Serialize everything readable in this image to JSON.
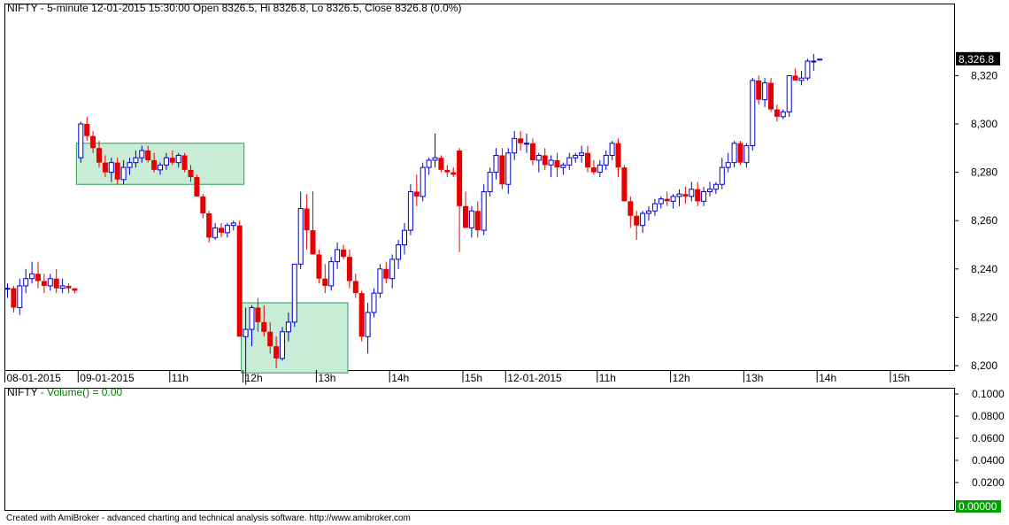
{
  "header": {
    "symbol": "NIFTY",
    "detail": " - 5-minute 12-01-2015 15:30:00 Open 8326.5, Hi 8326.8, Lo 8326.5, Close 8326.8 (0.0%)"
  },
  "volume_header": {
    "symbol": "NIFTY",
    "label": " - Volume() = 0.00"
  },
  "footer": "Created with AmiBroker - advanced charting and technical analysis software. http://www.amibroker.com",
  "colors": {
    "up": "#0000cc",
    "down": "#e60000",
    "box_fill": "#c8ecd6",
    "box_stroke": "#2f9c56",
    "last_tag": "#000000",
    "vol_tag": "#00a000",
    "volume_text": "#008000"
  },
  "chart_data": [
    {
      "type": "candlestick",
      "ylim": [
        8190,
        8330
      ],
      "yticks": [
        "8,200",
        "8,220",
        "8,240",
        "8,260",
        "8,280",
        "8,300",
        "8,320"
      ],
      "ytick_values": [
        8200,
        8220,
        8240,
        8260,
        8280,
        8300,
        8320
      ],
      "last_value_label": "8,326.8",
      "last_value": 8326.8,
      "x_labels": [
        {
          "label": "08-01-2015",
          "index": 0
        },
        {
          "label": "09-01-2015",
          "index": 12
        },
        {
          "label": "11h",
          "index": 27
        },
        {
          "label": "12h",
          "index": 39
        },
        {
          "label": "13h",
          "index": 51
        },
        {
          "label": "14h",
          "index": 63
        },
        {
          "label": "15h",
          "index": 75
        },
        {
          "label": "12-01-2015",
          "index": 82
        },
        {
          "label": "11h",
          "index": 97
        },
        {
          "label": "12h",
          "index": 109
        },
        {
          "label": "13h",
          "index": 121
        },
        {
          "label": "14h",
          "index": 133
        },
        {
          "label": "15h",
          "index": 145
        }
      ],
      "highlight_boxes": [
        {
          "from_index": 12,
          "to_index": 38,
          "low": 8275,
          "high": 8292
        },
        {
          "from_index": 39,
          "to_index": 55,
          "low": 8197,
          "high": 8226
        }
      ],
      "candles": [
        [
          8232,
          8234,
          8228,
          8232
        ],
        [
          8232,
          8233,
          8222,
          8224
        ],
        [
          8224,
          8236,
          8221,
          8233
        ],
        [
          8233,
          8240,
          8230,
          8236
        ],
        [
          8236,
          8243,
          8234,
          8238
        ],
        [
          8238,
          8243,
          8232,
          8235
        ],
        [
          8235,
          8238,
          8230,
          8233
        ],
        [
          8233,
          8238,
          8231,
          8236
        ],
        [
          8236,
          8240,
          8230,
          8232
        ],
        [
          8232,
          8236,
          8230,
          8233
        ],
        [
          8233,
          8234,
          8230,
          8232
        ],
        [
          8232,
          8232,
          8230,
          8231
        ],
        [
          8286,
          8301,
          8284,
          8300
        ],
        [
          8300,
          8303,
          8293,
          8295
        ],
        [
          8295,
          8297,
          8288,
          8290
        ],
        [
          8290,
          8293,
          8282,
          8284
        ],
        [
          8284,
          8287,
          8278,
          8280
        ],
        [
          8280,
          8286,
          8276,
          8284
        ],
        [
          8284,
          8286,
          8275,
          8277
        ],
        [
          8277,
          8285,
          8275,
          8282
        ],
        [
          8282,
          8286,
          8279,
          8284
        ],
        [
          8284,
          8289,
          8282,
          8286
        ],
        [
          8286,
          8291,
          8284,
          8289
        ],
        [
          8289,
          8291,
          8284,
          8285
        ],
        [
          8285,
          8288,
          8280,
          8281
        ],
        [
          8281,
          8284,
          8279,
          8283
        ],
        [
          8283,
          8288,
          8281,
          8286
        ],
        [
          8286,
          8289,
          8283,
          8284
        ],
        [
          8284,
          8288,
          8282,
          8287
        ],
        [
          8287,
          8288,
          8280,
          8281
        ],
        [
          8281,
          8283,
          8276,
          8278
        ],
        [
          8278,
          8279,
          8270,
          8270
        ],
        [
          8270,
          8271,
          8261,
          8263
        ],
        [
          8263,
          8264,
          8251,
          8253
        ],
        [
          8253,
          8259,
          8252,
          8257
        ],
        [
          8257,
          8259,
          8253,
          8255
        ],
        [
          8255,
          8259,
          8253,
          8258
        ],
        [
          8258,
          8260,
          8256,
          8259
        ],
        [
          8258,
          8260,
          8212,
          8212
        ],
        [
          8212,
          8224,
          8192,
          8215
        ],
        [
          8215,
          8225,
          8208,
          8224
        ],
        [
          8224,
          8228,
          8214,
          8218
        ],
        [
          8218,
          8225,
          8212,
          8214
        ],
        [
          8214,
          8218,
          8205,
          8208
        ],
        [
          8208,
          8212,
          8199,
          8203
        ],
        [
          8203,
          8216,
          8202,
          8214
        ],
        [
          8214,
          8222,
          8210,
          8218
        ],
        [
          8218,
          8242,
          8216,
          8242
        ],
        [
          8242,
          8272,
          8240,
          8265
        ],
        [
          8265,
          8271,
          8248,
          8256
        ],
        [
          8256,
          8272,
          8248,
          8246
        ],
        [
          8246,
          8248,
          8234,
          8236
        ],
        [
          8236,
          8242,
          8230,
          8233
        ],
        [
          8233,
          8245,
          8231,
          8243
        ],
        [
          8243,
          8251,
          8240,
          8248
        ],
        [
          8248,
          8250,
          8244,
          8245
        ],
        [
          8245,
          8248,
          8232,
          8235
        ],
        [
          8235,
          8238,
          8228,
          8230
        ],
        [
          8230,
          8231,
          8210,
          8212
        ],
        [
          8212,
          8226,
          8205,
          8222
        ],
        [
          8222,
          8232,
          8220,
          8230
        ],
        [
          8230,
          8242,
          8228,
          8240
        ],
        [
          8240,
          8243,
          8234,
          8236
        ],
        [
          8236,
          8246,
          8232,
          8244
        ],
        [
          8244,
          8252,
          8240,
          8250
        ],
        [
          8250,
          8259,
          8246,
          8256
        ],
        [
          8256,
          8275,
          8254,
          8272
        ],
        [
          8272,
          8279,
          8266,
          8270
        ],
        [
          8270,
          8284,
          8268,
          8282
        ],
        [
          8282,
          8286,
          8279,
          8285
        ],
        [
          8285,
          8296,
          8282,
          8286
        ],
        [
          8286,
          8287,
          8280,
          8281
        ],
        [
          8281,
          8283,
          8278,
          8280
        ],
        [
          8280,
          8282,
          8278,
          8279
        ],
        [
          8289,
          8290,
          8247,
          8266
        ],
        [
          8266,
          8272,
          8257,
          8257
        ],
        [
          8257,
          8266,
          8253,
          8264
        ],
        [
          8264,
          8268,
          8253,
          8256
        ],
        [
          8256,
          8275,
          8254,
          8272
        ],
        [
          8272,
          8282,
          8270,
          8280
        ],
        [
          8280,
          8290,
          8277,
          8287
        ],
        [
          8287,
          8290,
          8273,
          8275
        ],
        [
          8275,
          8290,
          8271,
          8288
        ],
        [
          8288,
          8297,
          8285,
          8294
        ],
        [
          8294,
          8297,
          8289,
          8292
        ],
        [
          8292,
          8296,
          8288,
          8292
        ],
        [
          8292,
          8294,
          8283,
          8285
        ],
        [
          8285,
          8288,
          8280,
          8287
        ],
        [
          8287,
          8290,
          8281,
          8283
        ],
        [
          8283,
          8287,
          8278,
          8285
        ],
        [
          8285,
          8288,
          8278,
          8282
        ],
        [
          8282,
          8284,
          8279,
          8283
        ],
        [
          8283,
          8288,
          8281,
          8286
        ],
        [
          8286,
          8288,
          8284,
          8287
        ],
        [
          8287,
          8291,
          8284,
          8288
        ],
        [
          8288,
          8291,
          8280,
          8282
        ],
        [
          8282,
          8285,
          8279,
          8280
        ],
        [
          8280,
          8285,
          8278,
          8283
        ],
        [
          8283,
          8289,
          8281,
          8287
        ],
        [
          8287,
          8293,
          8285,
          8292
        ],
        [
          8292,
          8294,
          8278,
          8282
        ],
        [
          8282,
          8283,
          8268,
          8268
        ],
        [
          8268,
          8270,
          8257,
          8262
        ],
        [
          8262,
          8264,
          8252,
          8258
        ],
        [
          8258,
          8264,
          8255,
          8263
        ],
        [
          8263,
          8266,
          8260,
          8264
        ],
        [
          8264,
          8269,
          8262,
          8267
        ],
        [
          8267,
          8270,
          8265,
          8269
        ],
        [
          8269,
          8272,
          8266,
          8268
        ],
        [
          8268,
          8271,
          8265,
          8270
        ],
        [
          8270,
          8273,
          8266,
          8271
        ],
        [
          8271,
          8274,
          8267,
          8270
        ],
        [
          8270,
          8276,
          8268,
          8273
        ],
        [
          8273,
          8276,
          8266,
          8268
        ],
        [
          8268,
          8274,
          8266,
          8272
        ],
        [
          8272,
          8276,
          8270,
          8273
        ],
        [
          8273,
          8276,
          8271,
          8275
        ],
        [
          8275,
          8286,
          8273,
          8282
        ],
        [
          8282,
          8288,
          8280,
          8284
        ],
        [
          8284,
          8293,
          8282,
          8292
        ],
        [
          8292,
          8293,
          8283,
          8284
        ],
        [
          8284,
          8292,
          8282,
          8291
        ],
        [
          8291,
          8319,
          8289,
          8318
        ],
        [
          8318,
          8320,
          8308,
          8310
        ],
        [
          8310,
          8319,
          8307,
          8317
        ],
        [
          8317,
          8319,
          8305,
          8306
        ],
        [
          8306,
          8308,
          8301,
          8303
        ],
        [
          8303,
          8306,
          8302,
          8305
        ],
        [
          8305,
          8320,
          8303,
          8320
        ],
        [
          8320,
          8323,
          8318,
          8318
        ],
        [
          8318,
          8322,
          8316,
          8319
        ],
        [
          8319,
          8327,
          8318,
          8326
        ],
        [
          8326,
          8329,
          8322,
          8326
        ],
        [
          8326.5,
          8326.8,
          8326.5,
          8326.8
        ]
      ]
    },
    {
      "type": "bar",
      "name": "Volume()",
      "ylim": [
        0,
        0.1
      ],
      "yticks": [
        "0.1000",
        "0.0800",
        "0.0600",
        "0.0400",
        "0.0200"
      ],
      "ytick_values": [
        0.1,
        0.08,
        0.06,
        0.04,
        0.02
      ],
      "last_value_label": "0.00000",
      "last_value": 0
    }
  ]
}
